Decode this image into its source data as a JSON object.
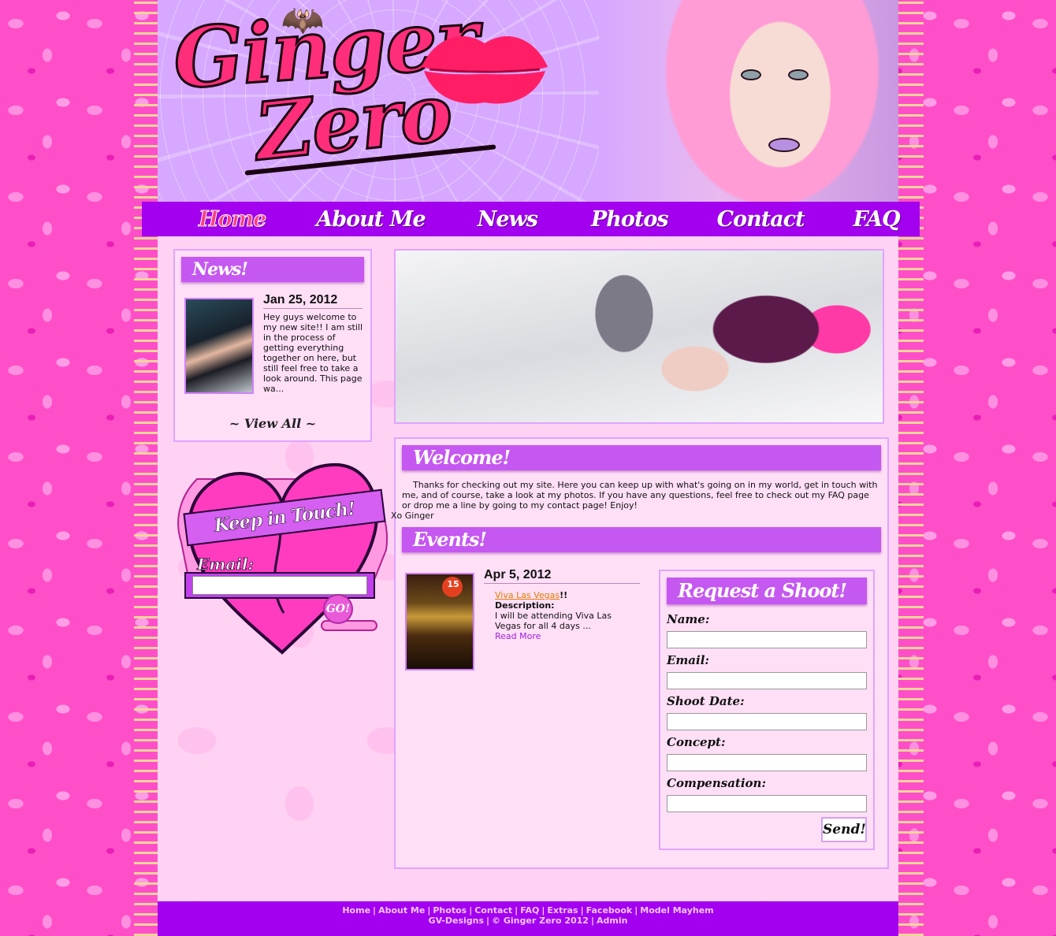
{
  "site": {
    "logo_line1": "Ginger",
    "logo_line2": "Zero"
  },
  "nav": {
    "items": [
      {
        "label": "Home",
        "active": true
      },
      {
        "label": "About Me",
        "active": false
      },
      {
        "label": "News",
        "active": false
      },
      {
        "label": "Photos",
        "active": false
      },
      {
        "label": "Contact",
        "active": false
      },
      {
        "label": "FAQ",
        "active": false
      }
    ]
  },
  "news": {
    "heading": "News!",
    "date": "Jan 25, 2012",
    "text": "Hey guys welcome to my new site!! I am still in the process of getting everything together on here, but still feel free to take a look around. This page wa...",
    "view_all": "~ View All ~"
  },
  "newsletter": {
    "banner": "Keep in Touch!",
    "email_label": "Email:",
    "email_value": "",
    "go_label": "GO!"
  },
  "welcome": {
    "heading": "Welcome!",
    "text": "Thanks for checking out my site. Here you can keep up with what's going on in my world, get in touch with me, and of course, take a look at my photos. If you have any questions, feel free to check out my FAQ page or drop me a line by going to my contact page! Enjoy!",
    "signoff": "Xo Ginger"
  },
  "events": {
    "heading": "Events!",
    "date": "Apr 5, 2012",
    "title_link": "Viva Las Vegas",
    "title_suffix": "!!",
    "desc_label": "Description:",
    "desc_text": "I will be attending Viva Las Vegas for all 4 days ...",
    "read_more": "Read More",
    "thumb_badge": "15"
  },
  "shoot_form": {
    "heading": "Request a Shoot!",
    "fields": [
      {
        "label": "Name:",
        "value": ""
      },
      {
        "label": "Email:",
        "value": ""
      },
      {
        "label": "Shoot Date:",
        "value": ""
      },
      {
        "label": "Concept:",
        "value": ""
      },
      {
        "label": "Compensation:",
        "value": ""
      }
    ],
    "send_label": "Send!"
  },
  "footer": {
    "links": [
      "Home",
      "About Me",
      "Photos",
      "Contact",
      "FAQ",
      "Extras",
      "Facebook",
      "Model Mayhem"
    ],
    "credit": "GV-Designs",
    "copyright": "© Ginger Zero 2012",
    "admin": "Admin"
  },
  "colors": {
    "nav_purple": "#a300f0",
    "header_lavender": "#d6a8ff",
    "page_pink": "#ff4fc8",
    "box_bg": "#ffdff6",
    "box_head": "#c558f0",
    "active_nav": "#ff3d86"
  }
}
